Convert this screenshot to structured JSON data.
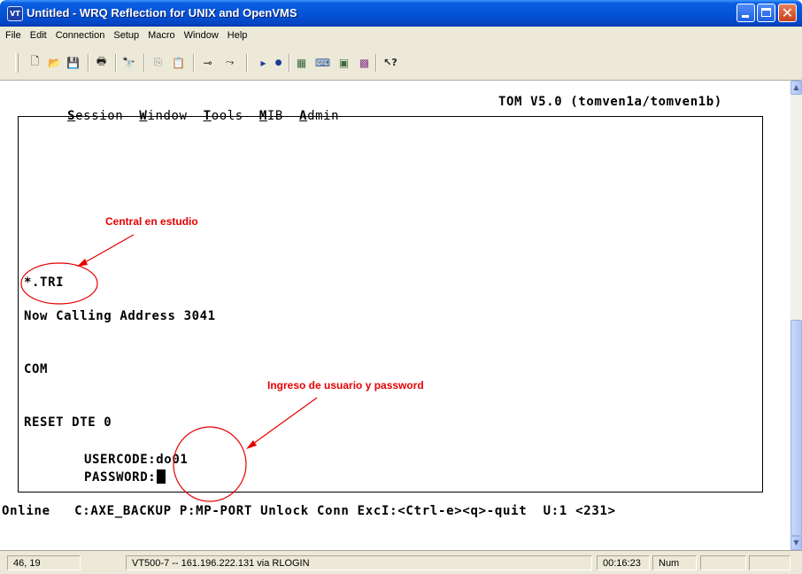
{
  "window": {
    "app_icon_text": "VT",
    "title": "Untitled - WRQ Reflection for UNIX and OpenVMS",
    "close_glyph": "✕"
  },
  "menubar": {
    "items": [
      "File",
      "Edit",
      "Connection",
      "Setup",
      "Macro",
      "Window",
      "Help"
    ]
  },
  "toolbar": {
    "icons": [
      "new-icon",
      "open-icon",
      "save-icon",
      "print-icon",
      "find-icon",
      "copy-icon",
      "paste-icon",
      "connect-icon",
      "disconnect-icon",
      "play-macro-icon",
      "record-macro-icon",
      "setup-icon",
      "keyboard-icon",
      "display-icon",
      "colors-icon",
      "help-icon"
    ],
    "glyphs": {
      "new": "🗋",
      "open": "📂",
      "save": "💾",
      "print": "🖶",
      "find": "🔭",
      "copy": "⎘",
      "paste": "📋",
      "connect": "⊸",
      "disconnect": "⤳",
      "play": "▸",
      "record": "●",
      "setup": "▦",
      "keyboard": "⌨",
      "display": "▣",
      "colors": "▩",
      "help": "↖?"
    }
  },
  "terminal": {
    "menu": [
      {
        "hot": "S",
        "rest": "ession"
      },
      {
        "hot": "W",
        "rest": "indow"
      },
      {
        "hot": "T",
        "rest": "ools"
      },
      {
        "hot": "M",
        "rest": "IB"
      },
      {
        "hot": "A",
        "rest": "dmin"
      }
    ],
    "version": "TOM V5.0 (tomven1a/tomven1b)",
    "lines": {
      "tri": "*.TRI",
      "calling": "Now Calling Address 3041",
      "com": "COM",
      "reset": "RESET DTE 0",
      "usercode_label": "USERCODE:",
      "usercode_value": "do01",
      "password_label": "PASSWORD:"
    },
    "status_line": "Online   C:AXE_BACKUP P:MP-PORT Unlock Conn ExcI:<Ctrl-e><q>-quit  U:1 <231>"
  },
  "annotations": {
    "central": "Central en estudio",
    "ingreso": "Ingreso de usuario y password",
    "color": "#e60000"
  },
  "statusbar": {
    "cursor_pos": "46, 19",
    "connection": "VT500-7 -- 161.196.222.131 via RLOGIN",
    "time": "00:16:23",
    "num": "Num"
  },
  "colors": {
    "titlebar": "#0552d6",
    "chrome": "#ece9d8",
    "terminal_bg": "#ffffff"
  }
}
